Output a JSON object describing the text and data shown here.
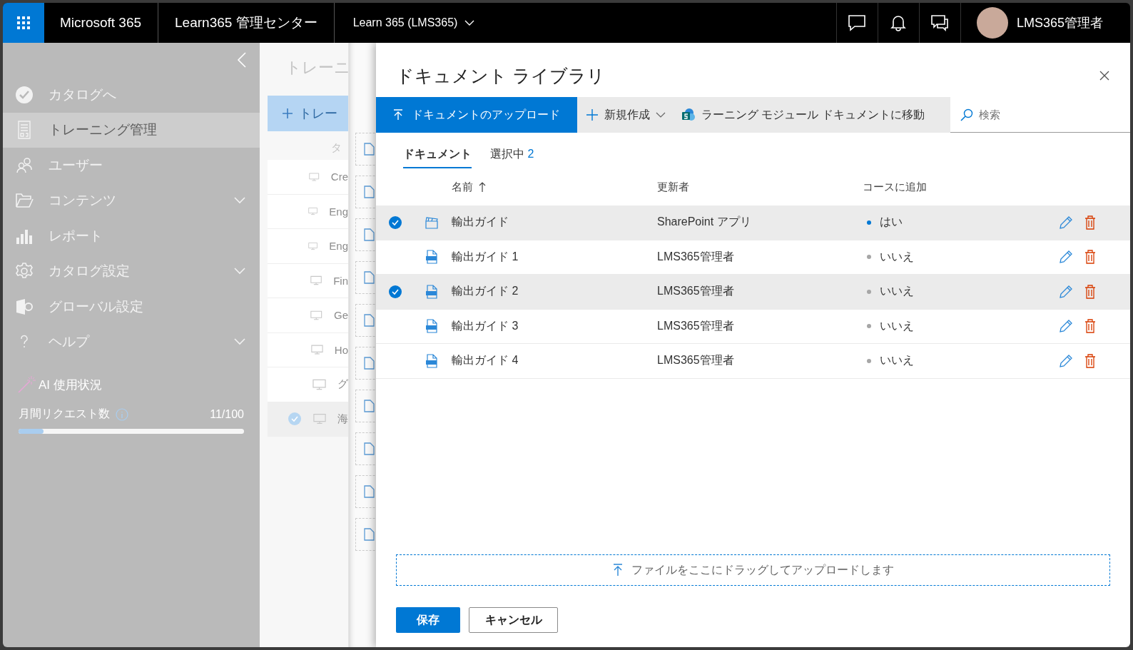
{
  "topbar": {
    "app_name": "Microsoft 365",
    "center_name": "Learn365 管理センター",
    "tenant": "Learn 365 (LMS365)",
    "user_name": "LMS365管理者"
  },
  "sidebar": {
    "items": [
      {
        "kind": "check",
        "label": "カタログへ",
        "selected": false,
        "expandable": false
      },
      {
        "kind": "form",
        "label": "トレーニング管理",
        "selected": true,
        "expandable": false
      },
      {
        "kind": "users",
        "label": "ユーザー",
        "selected": false,
        "expandable": false
      },
      {
        "kind": "folder",
        "label": "コンテンツ",
        "selected": false,
        "expandable": true
      },
      {
        "kind": "chart",
        "label": "レポート",
        "selected": false,
        "expandable": false
      },
      {
        "kind": "gear",
        "label": "カタログ設定",
        "selected": false,
        "expandable": true
      },
      {
        "kind": "admin",
        "label": "グローバル設定",
        "selected": false,
        "expandable": false
      },
      {
        "kind": "help",
        "label": "ヘルプ",
        "selected": false,
        "expandable": true
      }
    ],
    "ai_usage": {
      "title": "AI 使用状況",
      "label": "月間リクエスト数",
      "count": "11/100",
      "level": 0.11
    }
  },
  "background_page": {
    "title": "トレーニ",
    "add_button": "トレー",
    "column_header": "タ",
    "rows": [
      {
        "name": "Cre",
        "selected": false
      },
      {
        "name": "Eng",
        "selected": false
      },
      {
        "name": "Eng",
        "selected": false
      },
      {
        "name": "Fin",
        "selected": false
      },
      {
        "name": "Ge",
        "selected": false
      },
      {
        "name": "Ho",
        "selected": false
      },
      {
        "name": "グ",
        "selected": false
      },
      {
        "name": "海",
        "selected": true
      }
    ]
  },
  "dialog": {
    "title": "ドキュメント ライブラリ",
    "toolbar": {
      "upload": "ドキュメントのアップロード",
      "new": "新規作成",
      "move": "ラーニング モジュール ドキュメントに移動",
      "search_placeholder": "検索"
    },
    "tabs": [
      {
        "label": "ドキュメント",
        "selected": true
      },
      {
        "label": "選択中",
        "count": "2",
        "selected": false
      }
    ],
    "columns": [
      {
        "label": "名前",
        "sorted": true
      },
      {
        "label": "更新者",
        "sorted": false
      },
      {
        "label": "コースに追加",
        "sorted": false
      }
    ],
    "rows": [
      {
        "selected": true,
        "kind": "video",
        "name": "輸出ガイド",
        "modified_by": "SharePoint アプリ",
        "added": true,
        "added_label": "はい"
      },
      {
        "selected": false,
        "kind": "pdf",
        "name": "輸出ガイド 1",
        "modified_by": "LMS365管理者",
        "added": false,
        "added_label": "いいえ"
      },
      {
        "selected": true,
        "kind": "pdf",
        "name": "輸出ガイド 2",
        "modified_by": "LMS365管理者",
        "added": false,
        "added_label": "いいえ"
      },
      {
        "selected": false,
        "kind": "pdf",
        "name": "輸出ガイド 3",
        "modified_by": "LMS365管理者",
        "added": false,
        "added_label": "いいえ"
      },
      {
        "selected": false,
        "kind": "pdf",
        "name": "輸出ガイド 4",
        "modified_by": "LMS365管理者",
        "added": false,
        "added_label": "いいえ"
      }
    ],
    "drop_zone": "ファイルをここにドラッグしてアップロードします",
    "buttons": [
      {
        "kind": "primary",
        "label": "保存"
      },
      {
        "kind": "secondary",
        "label": "キャンセル"
      }
    ]
  }
}
